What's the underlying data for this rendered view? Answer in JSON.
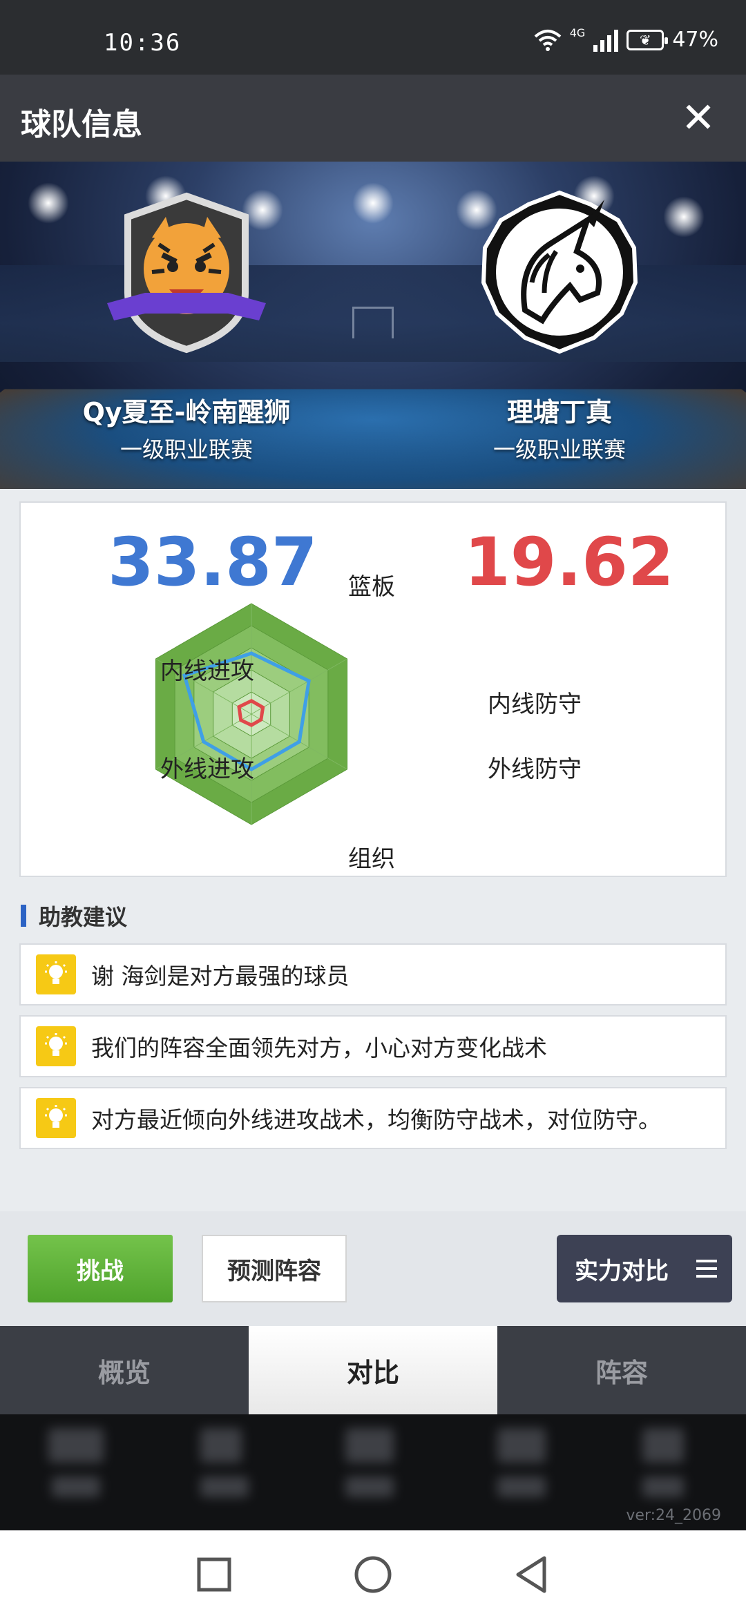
{
  "status_bar": {
    "time": "10:36",
    "network": "4G",
    "battery": "47%"
  },
  "header": {
    "title": "球队信息",
    "close_label": "✕"
  },
  "teams": {
    "left": {
      "name": "Qy夏至-岭南醒狮",
      "league": "一级职业联赛"
    },
    "right": {
      "name": "理塘丁真",
      "league": "一级职业联赛"
    }
  },
  "comparison": {
    "left_score": "33.87",
    "right_score": "19.62",
    "axes": [
      "篮板",
      "内线防守",
      "外线防守",
      "组织",
      "外线进攻",
      "内线进攻"
    ],
    "left_values": [
      0.55,
      0.6,
      0.5,
      0.5,
      0.5,
      0.7
    ],
    "right_values": [
      0.12,
      0.12,
      0.1,
      0.1,
      0.11,
      0.13
    ],
    "colors": {
      "left": "#3f9fe6",
      "right": "#e0484a",
      "radar_fill": "#6cae4a"
    }
  },
  "advice": {
    "title": "助教建议",
    "items": [
      "谢 海剑是对方最强的球员",
      "我们的阵容全面领先对方，小心对方变化战术",
      "对方最近倾向外线进攻战术，均衡防守战术，对位防守。"
    ]
  },
  "actions": {
    "challenge": "挑战",
    "predict": "预测阵容",
    "strength": "实力对比"
  },
  "tabs": [
    {
      "label": "概览",
      "active": false
    },
    {
      "label": "对比",
      "active": true
    },
    {
      "label": "阵容",
      "active": false
    }
  ],
  "version": "ver:24_2069"
}
